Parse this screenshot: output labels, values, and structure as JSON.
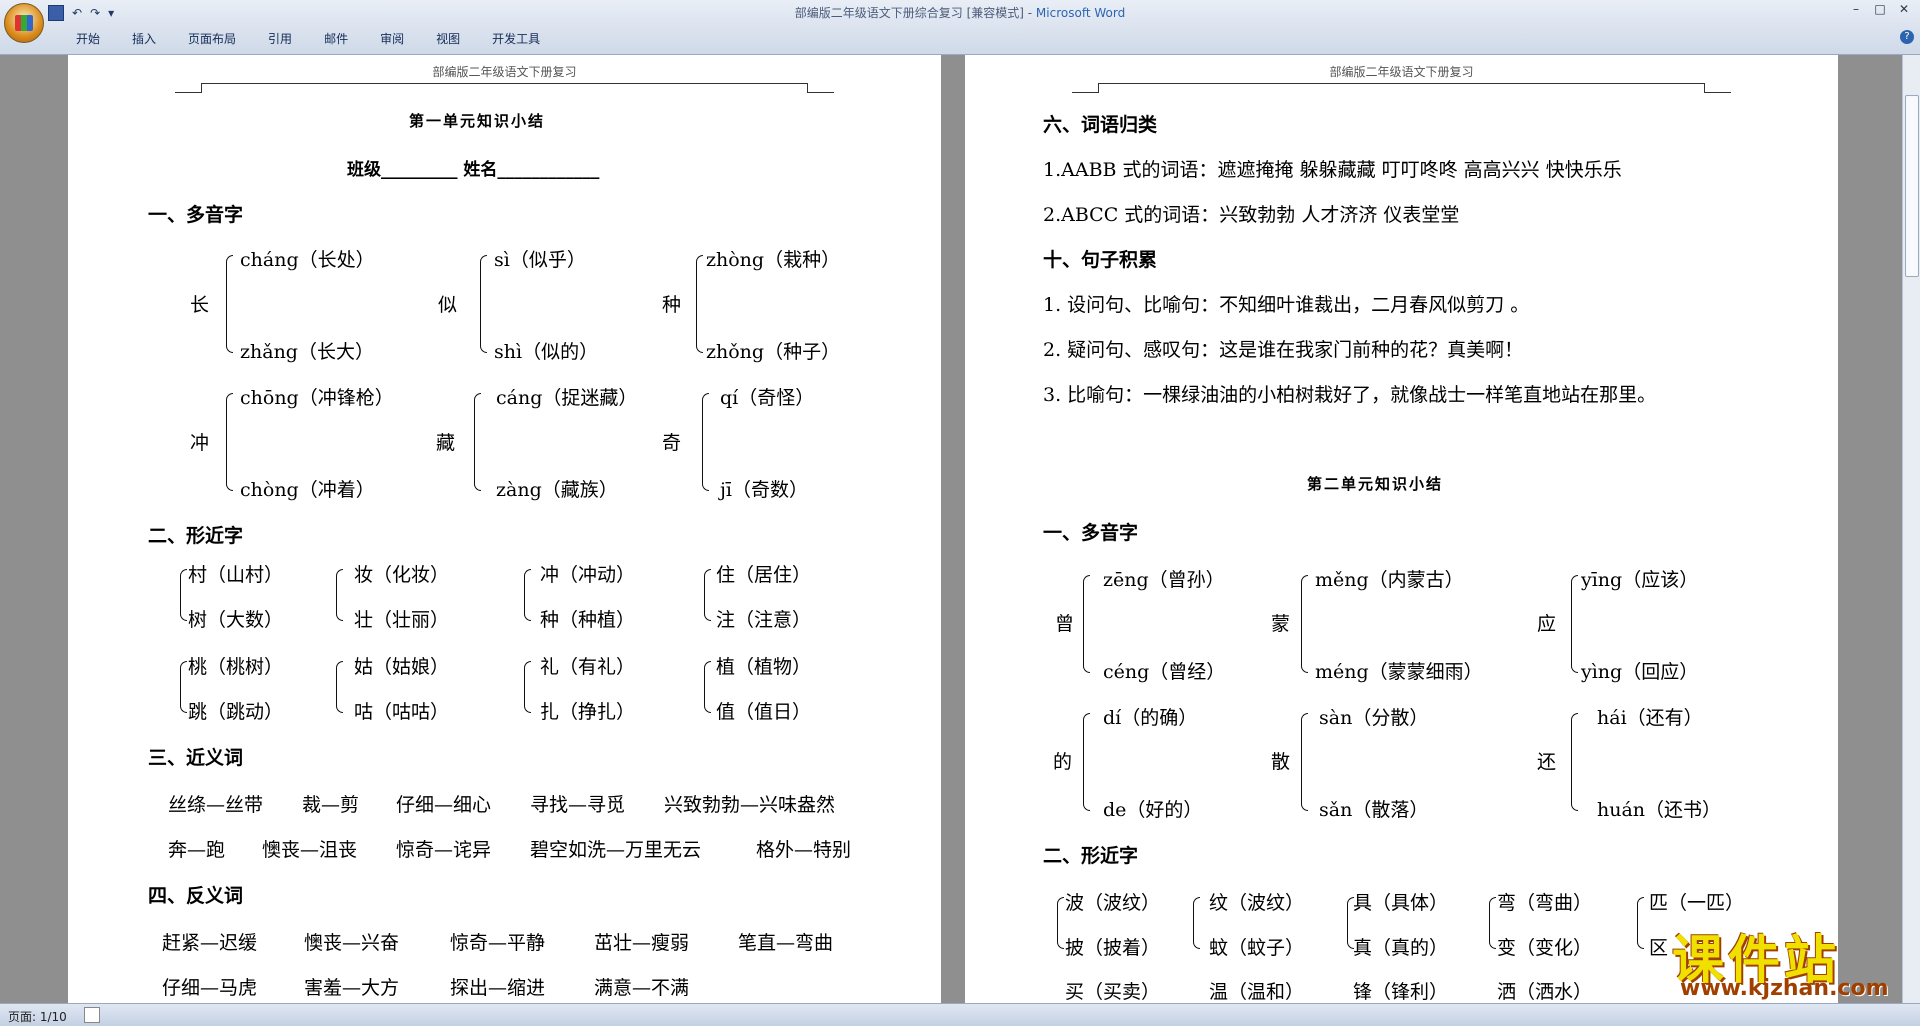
{
  "window": {
    "title_main": "部编版二年级语文下册综合复习 [兼容模式] - ",
    "title_brand": "Microsoft Word"
  },
  "qat": {
    "undo": "↶",
    "redo": "↷",
    "more": "▾"
  },
  "ribbon_tabs": [
    "开始",
    "插入",
    "页面布局",
    "引用",
    "邮件",
    "审阅",
    "视图",
    "开发工具"
  ],
  "header_text": "部编版二年级语文下册复习",
  "status": {
    "page": "页面: 1/10"
  },
  "watermark": {
    "name": "课件站",
    "url": "www.kjzhan.com"
  },
  "left": {
    "unit_title": "第一单元知识小结",
    "class_line": "班级_________    姓名____________",
    "s1": "一、多音字",
    "poly": [
      {
        "c": "长",
        "a": "cháng（长处）",
        "b": "zhǎng（长大）"
      },
      {
        "c": "似",
        "a": "sì（似乎）",
        "b": "shì（似的）"
      },
      {
        "c": "种",
        "a": "zhòng（栽种）",
        "b": "zhǒng（种子）"
      },
      {
        "c": "冲",
        "a": "chōng（冲锋枪）",
        "b": "chòng（冲着）"
      },
      {
        "c": "藏",
        "a": "cáng（捉迷藏）",
        "b": "zàng（藏族）"
      },
      {
        "c": "奇",
        "a": "qí（奇怪）",
        "b": "jī（奇数）"
      }
    ],
    "s2": "二、形近字",
    "shape": [
      {
        "a": "村（山村）",
        "b": "树（大数）"
      },
      {
        "a": "妆（化妆）",
        "b": "壮（壮丽）"
      },
      {
        "a": "冲（冲动）",
        "b": "种（种植）"
      },
      {
        "a": "住（居住）",
        "b": "注（注意）"
      },
      {
        "a": "桃（桃树）",
        "b": "跳（跳动）"
      },
      {
        "a": "姑（姑娘）",
        "b": "咕（咕咕）"
      },
      {
        "a": "礼（有礼）",
        "b": "扎（挣扎）"
      },
      {
        "a": "植（植物）",
        "b": "值（值日）"
      }
    ],
    "s3": "三、近义词",
    "syn1": [
      "丝绦—丝带",
      "裁—剪",
      "仔细—细心",
      "寻找—寻觅",
      "兴致勃勃—兴味盎然"
    ],
    "syn2": [
      "奔—跑",
      "懊丧—沮丧",
      "惊奇—诧异",
      "碧空如洗—万里无云",
      "格外—特别"
    ],
    "s4": "四、反义词",
    "ant1": [
      "赶紧—迟缓",
      "懊丧—兴奋",
      "惊奇—平静",
      "茁壮—瘦弱",
      "笔直—弯曲"
    ],
    "ant2": [
      "仔细—马虎",
      "害羞—大方",
      "探出—缩进",
      "满意—不满"
    ]
  },
  "right": {
    "s6": "六、词语归类",
    "l1": "1.AABB 式的词语：遮遮掩掩      躲躲藏藏      叮叮咚咚  高高兴兴  快快乐乐",
    "l2": "2.ABCC 式的词语：兴致勃勃   人才济济    仪表堂堂",
    "s10": "十、句子积累",
    "q1": "1. 设问句、比喻句：不知细叶谁裁出，二月春风似剪刀 。",
    "q2": "2. 疑问句、感叹句：这是谁在我家门前种的花？真美啊！",
    "q3": "3. 比喻句：一棵绿油油的小柏树栽好了，就像战士一样笔直地站在那里。",
    "unit2_title": "第二单元知识小结",
    "s1": "一、多音字",
    "poly": [
      {
        "c": "曾",
        "a": "zēng（曾孙）",
        "b": "céng（曾经）"
      },
      {
        "c": "蒙",
        "a": "měng（内蒙古）",
        "b": "méng（蒙蒙细雨）"
      },
      {
        "c": "应",
        "a": "yīng（应该）",
        "b": "yìng（回应）"
      },
      {
        "c": "的",
        "a": "dí（的确）",
        "b": "de（好的）"
      },
      {
        "c": "散",
        "a": "sàn（分散）",
        "b": "sǎn（散落）"
      },
      {
        "c": "还",
        "a": "hái（还有）",
        "b": "huán（还书）"
      }
    ],
    "s2": "二、形近字",
    "shape": [
      {
        "a": "波（波纹）",
        "b": "披（披着）"
      },
      {
        "a": "纹（波纹）",
        "b": "蚊（蚊子）"
      },
      {
        "a": "具（具体）",
        "b": "真（真的）"
      },
      {
        "a": "弯（弯曲）",
        "b": "变（变化）"
      },
      {
        "a": "匹（一匹）",
        "b": "区"
      }
    ],
    "shape3": [
      "买（买卖）",
      "温（温和）",
      "锋（锋利）",
      "洒（洒水）"
    ]
  }
}
